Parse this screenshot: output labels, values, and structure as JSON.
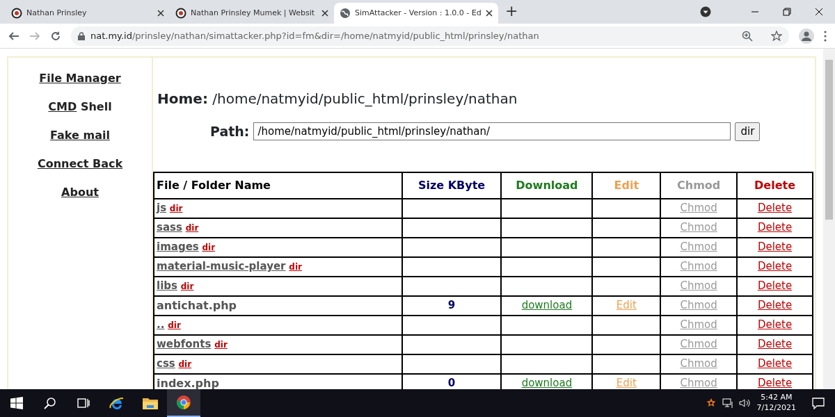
{
  "browser": {
    "tabs": [
      {
        "title": "Nathan Prinsley",
        "kind": "site",
        "selected": false
      },
      {
        "title": "Nathan Prinsley Mumek | Websit",
        "kind": "site",
        "selected": false
      },
      {
        "title": "SimAttacker - Version : 1.0.0 - Ed",
        "kind": "page",
        "selected": true
      }
    ],
    "new_tab": "+",
    "url_host": "nat.my.id",
    "url_path": "/prinsley/nathan/simattacker.php?id=fm&dir=/home/natmyid/public_html/prinsley/nathan"
  },
  "sidebar": {
    "items": [
      {
        "parts": [
          "File Manager"
        ]
      },
      {
        "parts": [
          "CMD",
          "Shell"
        ]
      },
      {
        "parts": [
          "Fake mail"
        ]
      },
      {
        "parts": [
          "Connect Back"
        ]
      },
      {
        "parts": [
          "About"
        ]
      }
    ]
  },
  "home": {
    "label": "Home:",
    "value": "/home/natmyid/public_html/prinsley/nathan"
  },
  "path": {
    "label": "Path:",
    "value": "/home/natmyid/public_html/prinsley/nathan/",
    "button": "dir"
  },
  "table": {
    "columns": [
      {
        "label": "File / Folder Name",
        "color": "#000000"
      },
      {
        "label": "Size KByte",
        "color": "#000066"
      },
      {
        "label": "Download",
        "color": "#1e7b1e"
      },
      {
        "label": "Edit",
        "color": "#f0a050"
      },
      {
        "label": "Chmod",
        "color": "#999999"
      },
      {
        "label": "Delete",
        "color": "#c00000"
      }
    ],
    "rows": [
      {
        "kind": "dir",
        "name": "js",
        "tag": "dir",
        "chmod": "Chmod",
        "delete": "Delete"
      },
      {
        "kind": "dir",
        "name": "sass",
        "tag": "dir",
        "chmod": "Chmod",
        "delete": "Delete"
      },
      {
        "kind": "dir",
        "name": "images",
        "tag": "dir",
        "chmod": "Chmod",
        "delete": "Delete"
      },
      {
        "kind": "dir",
        "name": "material-music-player",
        "tag": "dir",
        "chmod": "Chmod",
        "delete": "Delete"
      },
      {
        "kind": "dir",
        "name": "libs",
        "tag": "dir",
        "chmod": "Chmod",
        "delete": "Delete"
      },
      {
        "kind": "file",
        "name": "antichat.php",
        "size": "9",
        "download": "download",
        "edit": "Edit",
        "chmod": "Chmod",
        "delete": "Delete"
      },
      {
        "kind": "dir",
        "name": "..",
        "tag": "dir",
        "chmod": "Chmod",
        "delete": "Delete"
      },
      {
        "kind": "dir",
        "name": "webfonts",
        "tag": "dir",
        "chmod": "Chmod",
        "delete": "Delete"
      },
      {
        "kind": "dir",
        "name": "css",
        "tag": "dir",
        "chmod": "Chmod",
        "delete": "Delete"
      },
      {
        "kind": "file",
        "name": "index.php",
        "size": "0",
        "download": "download",
        "edit": "Edit",
        "chmod": "Chmod",
        "delete": "Delete"
      }
    ]
  },
  "taskbar": {
    "time": "5:42 AM",
    "date": "7/12/2021"
  }
}
